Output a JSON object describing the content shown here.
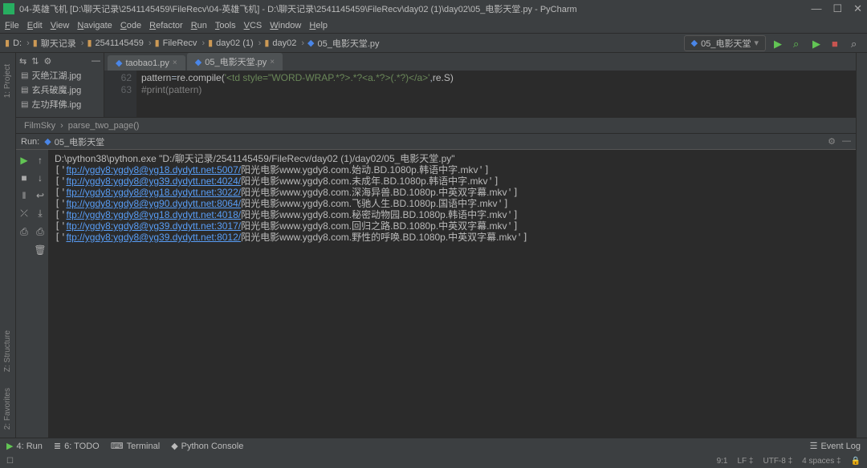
{
  "title": "04-英雄飞机 [D:\\聊天记录\\2541145459\\FileRecv\\04-英雄飞机] - D:\\聊天记录\\2541145459\\FileRecv\\day02 (1)\\day02\\05_电影天堂.py - PyCharm",
  "menu": [
    "File",
    "Edit",
    "View",
    "Navigate",
    "Code",
    "Refactor",
    "Run",
    "Tools",
    "VCS",
    "Window",
    "Help"
  ],
  "crumbs": [
    {
      "icon": "folder",
      "text": "D:"
    },
    {
      "icon": "folder",
      "text": "聊天记录"
    },
    {
      "icon": "folder",
      "text": "2541145459"
    },
    {
      "icon": "folder",
      "text": "FileRecv"
    },
    {
      "icon": "folder",
      "text": "day02 (1)"
    },
    {
      "icon": "folder",
      "text": "day02"
    },
    {
      "icon": "py",
      "text": "05_电影天堂.py"
    }
  ],
  "run_config": "05_电影天堂",
  "left_labels": {
    "project": "1: Project",
    "structure": "Z: Structure",
    "favorites": "2: Favorites"
  },
  "project_items": [
    "灭绝江湖.jpg",
    "玄兵破魔.jpg",
    "左功拜佛.ipg"
  ],
  "tabs": [
    {
      "name": "taobao1.py"
    },
    {
      "name": "05_电影天堂.py"
    }
  ],
  "code": {
    "lines": [
      {
        "num": "62",
        "html": "pattern<span class='s-fn'>=</span>re.compile(<span class='s-str'>'&lt;td style=\"WORD-WRAP.*?&gt;.*?&lt;a.*?&gt;(.*?)&lt;/a&gt;'</span><span class='s-fn'>,</span>re.S)"
      },
      {
        "num": "63",
        "html": "<span class='s-comment'>#print(pattern)</span>"
      }
    ]
  },
  "crumb_bar": {
    "a": "FilmSky",
    "b": "parse_two_page()"
  },
  "run_tab_label": "Run:",
  "run_tab_name": "05_电影天堂",
  "output": {
    "first": "D:\\python38\\python.exe \"D:/聊天记录/2541145459/FileRecv/day02 (1)/day02/05_电影天堂.py\"",
    "rows": [
      {
        "url": "ftp://ygdy8:ygdy8@yg18.dydytt.net:5007/",
        "rest": "阳光电影www.ygdy8.com.始动.BD.1080p.韩语中字.mkv"
      },
      {
        "url": "ftp://ygdy8:ygdy8@yg39.dydytt.net:4024/",
        "rest": "阳光电影www.ygdy8.com.未成年.BD.1080p.韩语中字.mkv"
      },
      {
        "url": "ftp://ygdy8:ygdy8@yg18.dydytt.net:3022/",
        "rest": "阳光电影www.ygdy8.com.深海异兽.BD.1080p.中英双字幕.mkv"
      },
      {
        "url": "ftp://ygdy8:ygdy8@yg90.dydytt.net:8064/",
        "rest": "阳光电影www.ygdy8.com.飞驰人生.BD.1080p.国语中字.mkv"
      },
      {
        "url": "ftp://ygdy8:ygdy8@yg18.dydytt.net:4018/",
        "rest": "阳光电影www.ygdy8.com.秘密动物园.BD.1080p.韩语中字.mkv"
      },
      {
        "url": "ftp://ygdy8:ygdy8@yg39.dydytt.net:3017/",
        "rest": "阳光电影www.ygdy8.com.回归之路.BD.1080p.中英双字幕.mkv"
      },
      {
        "url": "ftp://ygdy8:ygdy8@yg39.dydytt.net:8012/",
        "rest": "阳光电影www.ygdy8.com.野性的呼唤.BD.1080p.中英双字幕.mkv"
      }
    ]
  },
  "footer": {
    "run": "4: Run",
    "todo": "6: TODO",
    "terminal": "Terminal",
    "python": "Python Console",
    "eventlog": "Event Log"
  },
  "status": {
    "pos": "9:1",
    "lf": "LF",
    "enc": "UTF-8",
    "spaces": "4 spaces"
  }
}
